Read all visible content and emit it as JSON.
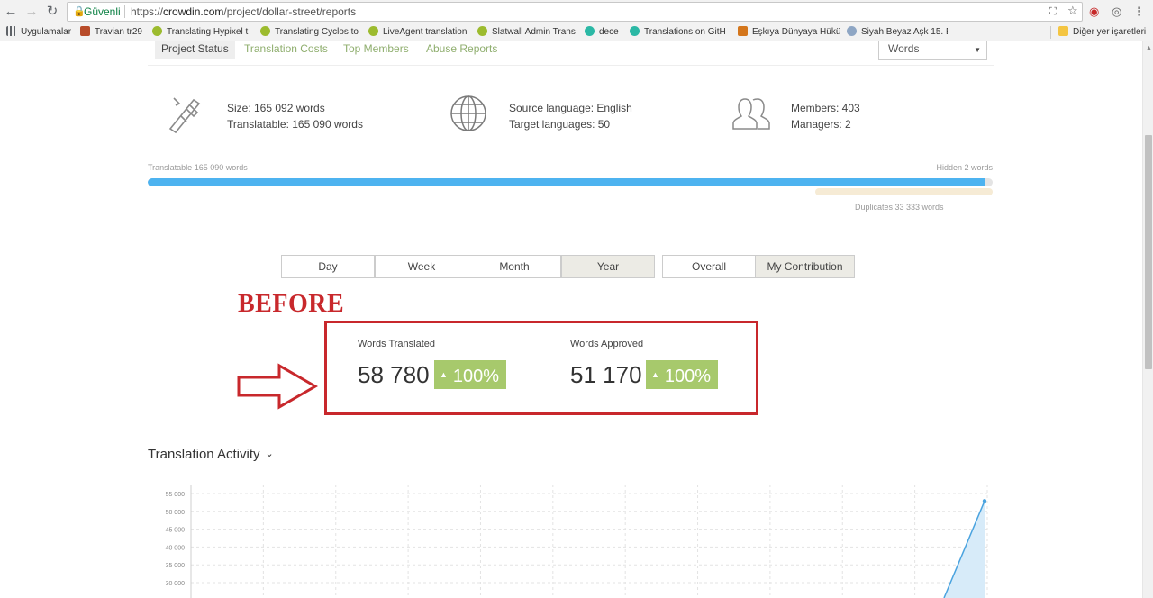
{
  "browser": {
    "secure_label": "Güvenli",
    "url_scheme": "https://",
    "url_host": "crowdin.com",
    "url_path": "/project/dollar-street/reports",
    "bookmarks": [
      {
        "label": "Uygulamalar",
        "color": "#5f6368"
      },
      {
        "label": "Travian tr29",
        "color": "#b84c2a"
      },
      {
        "label": "Translating Hypixel t",
        "color": "#9cbb2e"
      },
      {
        "label": "Translating Cyclos to",
        "color": "#9cbb2e"
      },
      {
        "label": "LiveAgent translation",
        "color": "#9cbb2e"
      },
      {
        "label": "Slatwall Admin Trans",
        "color": "#9cbb2e"
      },
      {
        "label": "dece",
        "color": "#2bb8a5"
      },
      {
        "label": "Translations on GitH",
        "color": "#2bb8a5"
      },
      {
        "label": "Eşkıya Dünyaya Hükü",
        "color": "#d4761c"
      },
      {
        "label": "Siyah Beyaz Aşk 15. E",
        "color": "#8ea6c4"
      }
    ],
    "other_bookmarks": "Diğer yer işaretleri"
  },
  "report_tabs": [
    {
      "label": "Project Status",
      "active": true
    },
    {
      "label": "Translation Costs",
      "active": false
    },
    {
      "label": "Top Members",
      "active": false
    },
    {
      "label": "Abuse Reports",
      "active": false
    }
  ],
  "units_select": "Words",
  "stats": {
    "size": "Size: 165 092 words",
    "translatable": "Translatable: 165 090 words",
    "source_language": "Source language: English",
    "target_languages": "Target languages: 50",
    "members": "Members: 403",
    "managers": "Managers: 2"
  },
  "progress": {
    "translatable_label": "Translatable 165 090 words",
    "hidden_label": "Hidden 2 words",
    "duplicates_label": "Duplicates 33 333 words",
    "translatable_fraction": 0.99,
    "duplicates_fraction": 0.21
  },
  "period_tabs": [
    {
      "label": "Day",
      "active": false
    },
    {
      "label": "Week",
      "active": false
    },
    {
      "label": "Month",
      "active": false
    },
    {
      "label": "Year",
      "active": true
    }
  ],
  "scope_tabs": [
    {
      "label": "Overall",
      "active": false
    },
    {
      "label": "My Contribution",
      "active": true
    }
  ],
  "annotation": {
    "text": "BEFORE",
    "color": "#c8282c"
  },
  "metrics": {
    "words_translated": {
      "label": "Words Translated",
      "value": "58 780",
      "change": "100%"
    },
    "words_approved": {
      "label": "Words Approved",
      "value": "51 170",
      "change": "100%"
    }
  },
  "section_title": "Translation Activity",
  "chart_data": {
    "type": "area",
    "title": "",
    "y_ticks": [
      "55 000",
      "50 000",
      "45 000",
      "40 000",
      "35 000",
      "30 000"
    ],
    "ylim": [
      30000,
      55000
    ],
    "series": [
      {
        "values_end": 52900
      }
    ],
    "color": "#4aa3df",
    "grid": true
  }
}
